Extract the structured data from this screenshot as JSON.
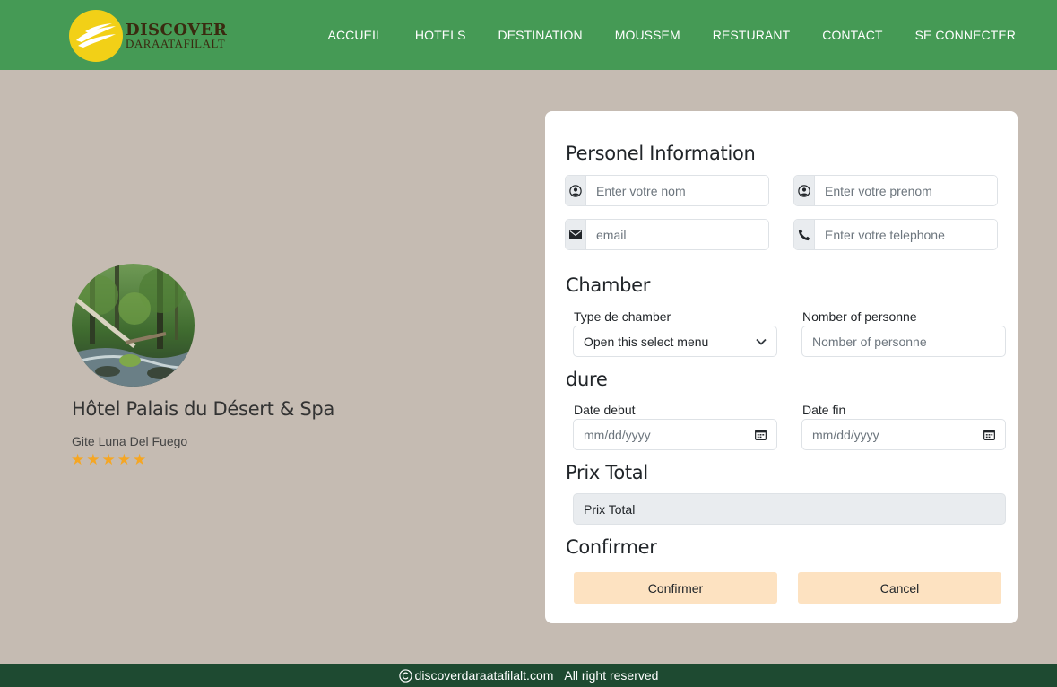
{
  "brand": {
    "name": "DISCOVER",
    "tagline": "DARAATAFILALT",
    "colors": {
      "navbar": "#459a55",
      "logo_circle": "#f2d017",
      "footer": "#1e4a31",
      "button": "#fde2c1",
      "star": "#f5a623"
    }
  },
  "nav": {
    "items": [
      {
        "label": "ACCUEIL"
      },
      {
        "label": "HOTELS"
      },
      {
        "label": "DESTINATION"
      },
      {
        "label": "MOUSSEM"
      },
      {
        "label": "RESTURANT"
      },
      {
        "label": "CONTACT"
      },
      {
        "label": "SE CONNECTER"
      }
    ]
  },
  "hotel": {
    "name": "Hôtel Palais du Désert & Spa",
    "subtitle": "Gite Luna Del Fuego",
    "rating": 5,
    "image_icon": "forest-stream-photo"
  },
  "form": {
    "personal": {
      "title": "Personel Information",
      "nom_placeholder": "Enter votre nom",
      "prenom_placeholder": "Enter votre prenom",
      "email_placeholder": "email",
      "telephone_placeholder": "Enter votre telephone",
      "icons": {
        "nom": "user-circle-icon",
        "prenom": "user-circle-icon",
        "email": "envelope-icon",
        "telephone": "phone-icon"
      }
    },
    "chamber": {
      "title": "Chamber",
      "type_label": "Type de chamber",
      "type_selected": "Open this select menu",
      "personne_label": "Nomber of personne",
      "personne_placeholder": "Nomber of personne"
    },
    "dure": {
      "title": "dure",
      "debut_label": "Date debut",
      "debut_placeholder": "mm/dd/yyyy",
      "fin_label": "Date fin",
      "fin_placeholder": "mm/dd/yyyy"
    },
    "prix": {
      "title": "Prix Total",
      "value": "Prix Total"
    },
    "confirm": {
      "title": "Confirmer",
      "confirm_label": "Confirmer",
      "cancel_label": "Cancel"
    }
  },
  "footer": {
    "site": "discoverdaraatafilalt.com",
    "rights": "All right reserved"
  }
}
